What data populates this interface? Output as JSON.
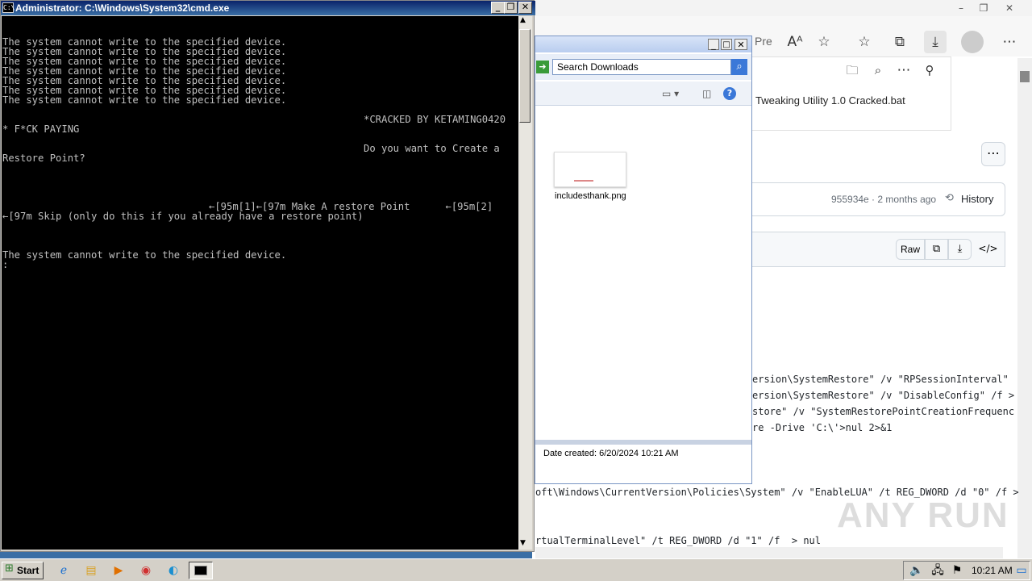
{
  "browser": {
    "address_partial": "Pre",
    "downloads_file": "Tweaking Utility 1.0 Cracked.bat",
    "commit": "955934e · 2 months ago",
    "history_label": "History",
    "raw_label": "Raw",
    "code_lines": [
      "ersion\\SystemRestore\" /v \"RPSessionInterval\"",
      "ersion\\SystemRestore\" /v \"DisableConfig\" /f >",
      "store\" /v \"SystemRestorePointCreationFrequenc",
      "re -Drive 'C:\\'>nul 2>&1",
      "oft\\Windows\\CurrentVersion\\Policies\\System\" /v \"EnableLUA\" /t REG_DWORD /d \"0\" /f >",
      "rtualTerminalLevel\" /t REG_DWORD /d \"1\" /f  > nul"
    ],
    "watermark": "ANY RUN"
  },
  "explorer": {
    "search_placeholder": "Search Downloads",
    "file_name": "includesthank.png",
    "date_created": "Date created: 6/20/2024 10:21 AM"
  },
  "cmd": {
    "title": "Administrator: C:\\Windows\\System32\\cmd.exe",
    "lines": [
      {
        "row": 2,
        "col": 0,
        "text": "The system cannot write to the specified device."
      },
      {
        "row": 3,
        "col": 0,
        "text": "The system cannot write to the specified device."
      },
      {
        "row": 4,
        "col": 0,
        "text": "The system cannot write to the specified device."
      },
      {
        "row": 5,
        "col": 0,
        "text": "The system cannot write to the specified device."
      },
      {
        "row": 6,
        "col": 0,
        "text": "The system cannot write to the specified device."
      },
      {
        "row": 7,
        "col": 0,
        "text": "The system cannot write to the specified device."
      },
      {
        "row": 8,
        "col": 0,
        "text": "The system cannot write to the specified device."
      },
      {
        "row": 10,
        "col": 56,
        "text": "*CRACKED BY KETAMING0420"
      },
      {
        "row": 11,
        "col": 0,
        "text": "* F*CK PAYING"
      },
      {
        "row": 13,
        "col": 56,
        "text": "Do you want to Create a"
      },
      {
        "row": 14,
        "col": 0,
        "text": "Restore Point?"
      },
      {
        "row": 19,
        "col": 32,
        "text": "←[95m[1]←[97m Make A restore Point      ←[95m[2]"
      },
      {
        "row": 20,
        "col": 0,
        "text": "←[97m Skip (only do this if you already have a restore point)"
      },
      {
        "row": 24,
        "col": 0,
        "text": "The system cannot write to the specified device."
      },
      {
        "row": 25,
        "col": 0,
        "text": ":"
      }
    ]
  },
  "taskbar": {
    "start_label": "Start",
    "clock": "10:21 AM"
  }
}
